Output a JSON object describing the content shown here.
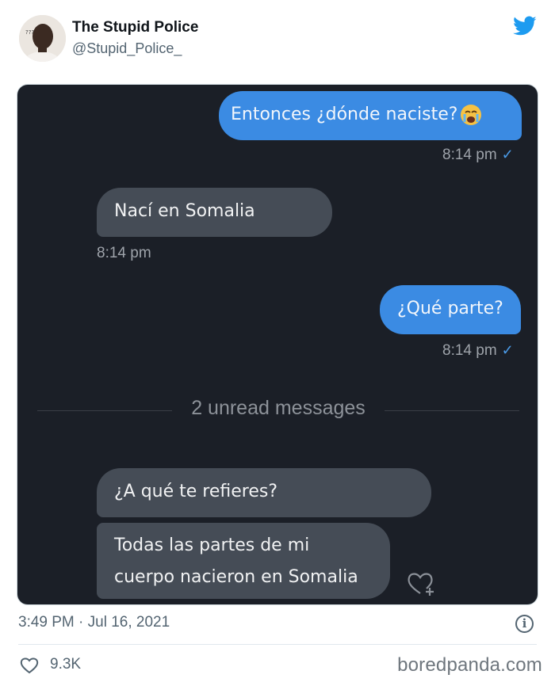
{
  "author": {
    "name": "The Stupid Police",
    "handle": "@Stupid_Police_"
  },
  "icons": {
    "avatar": "avatar",
    "brand": "twitter-bird-icon",
    "read_receipt": "check-icon",
    "react": "heart-plus-icon",
    "info": "info-icon",
    "like": "heart-icon"
  },
  "colors": {
    "twitter_blue": "#1d9bf0",
    "chat_bg": "#1b1f27",
    "outgoing_bubble": "#3b8be3",
    "incoming_bubble": "#454c56"
  },
  "chat": {
    "messages": [
      {
        "direction": "out",
        "text": "Entonces ¿dónde naciste?",
        "emoji": "crying-face",
        "time": "8:14 pm",
        "read": true
      },
      {
        "direction": "in",
        "text": "Nací en Somalia",
        "time": "8:14 pm"
      },
      {
        "direction": "out",
        "text": "¿Qué parte?",
        "time": "8:14 pm",
        "read": true
      },
      {
        "direction": "in",
        "text": "¿A qué te refieres?"
      },
      {
        "direction": "in",
        "lines": [
          "Todas las partes de mi",
          "cuerpo nacieron en Somalia"
        ]
      }
    ],
    "check_glyph": "✓",
    "unread_divider": "2 unread messages"
  },
  "footer": {
    "timestamp": "3:49 PM · Jul 16, 2021",
    "info_glyph": "i",
    "likes": "9.3K"
  },
  "watermark": "boredpanda.com"
}
